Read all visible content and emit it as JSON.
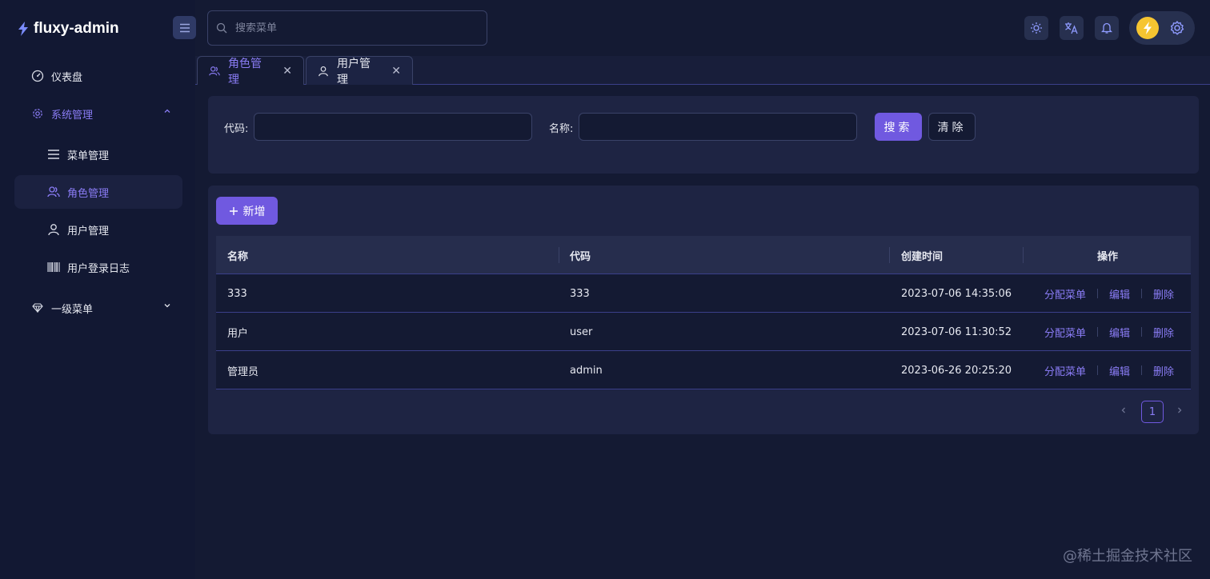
{
  "app": {
    "title": "fluxy-admin"
  },
  "header": {
    "search_placeholder": "搜索菜单"
  },
  "sidebar": {
    "items": [
      {
        "label": "仪表盘",
        "icon": "dashboard-icon"
      },
      {
        "label": "系统管理",
        "icon": "gear-icon",
        "expanded": true
      },
      {
        "label": "菜单管理",
        "icon": "menu-list-icon"
      },
      {
        "label": "角色管理",
        "icon": "users-icon",
        "active": true
      },
      {
        "label": "用户管理",
        "icon": "user-icon"
      },
      {
        "label": "用户登录日志",
        "icon": "barcode-icon"
      },
      {
        "label": "一级菜单",
        "icon": "diamond-icon",
        "expanded": false
      }
    ]
  },
  "tabs": [
    {
      "label": "角色管理",
      "active": true
    },
    {
      "label": "用户管理",
      "active": false
    }
  ],
  "filter": {
    "code_label": "代码:",
    "name_label": "名称:",
    "code_value": "",
    "name_value": "",
    "search_button": "搜索",
    "clear_button": "清除"
  },
  "toolbar": {
    "add_button": "新增"
  },
  "table": {
    "headers": [
      "名称",
      "代码",
      "创建时间",
      "操作"
    ],
    "rows": [
      {
        "name": "333",
        "code": "333",
        "created": "2023-07-06 14:35:06"
      },
      {
        "name": "用户",
        "code": "user",
        "created": "2023-07-06 11:30:52"
      },
      {
        "name": "管理员",
        "code": "admin",
        "created": "2023-06-26 20:25:20"
      }
    ],
    "actions": {
      "assign": "分配菜单",
      "edit": "编辑",
      "delete": "删除"
    }
  },
  "pagination": {
    "current_page": "1"
  },
  "watermark": "@稀土掘金技术社区",
  "colors": {
    "accent": "#7059e0",
    "accent_text": "#8a7cf5",
    "background": "#141a33",
    "panel": "#1e2443"
  }
}
